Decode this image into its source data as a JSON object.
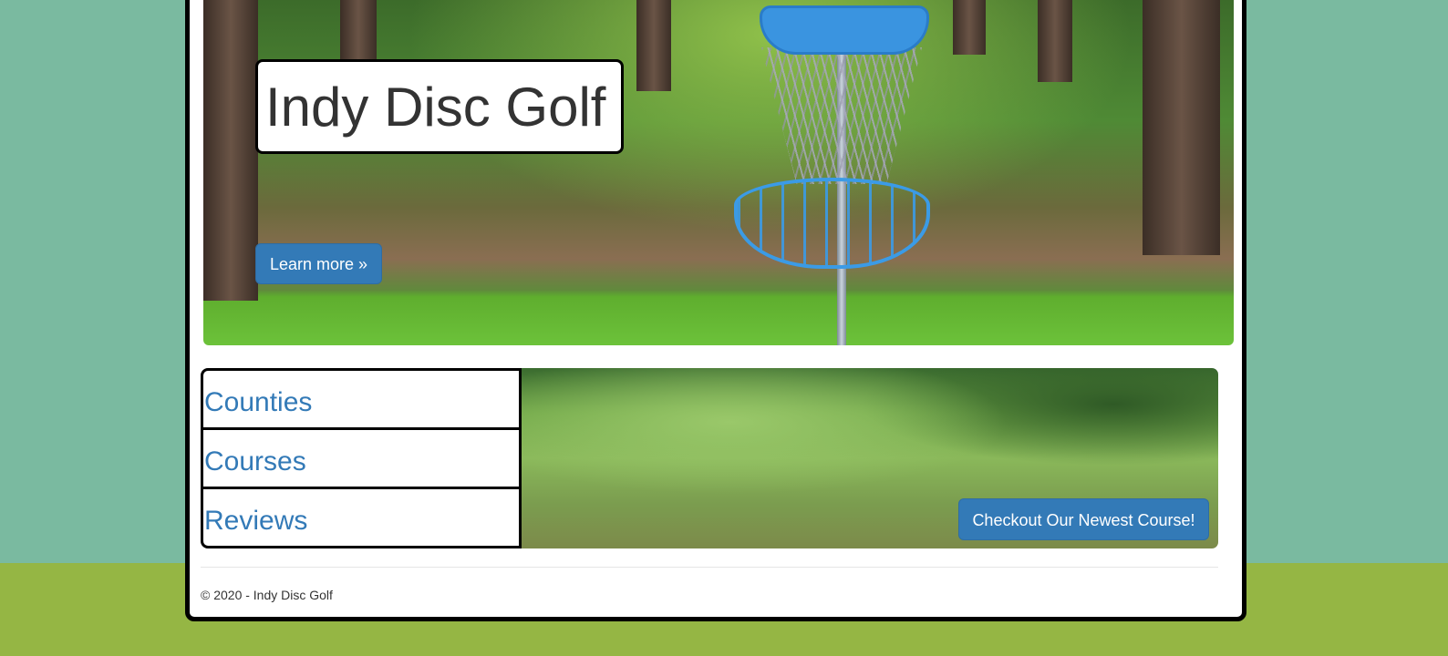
{
  "hero": {
    "title": "Indy Disc Golf",
    "learn_more_label": "Learn more »"
  },
  "nav": {
    "items": [
      {
        "label": "Counties"
      },
      {
        "label": "Courses"
      },
      {
        "label": "Reviews"
      }
    ]
  },
  "feature": {
    "checkout_label": "Checkout Our Newest Course!"
  },
  "footer": {
    "copyright": "© 2020 - Indy Disc Golf"
  },
  "colors": {
    "page_top": "#7abaa0",
    "page_bottom": "#95b644",
    "primary_button": "#337ab7",
    "link": "#337ab7"
  }
}
